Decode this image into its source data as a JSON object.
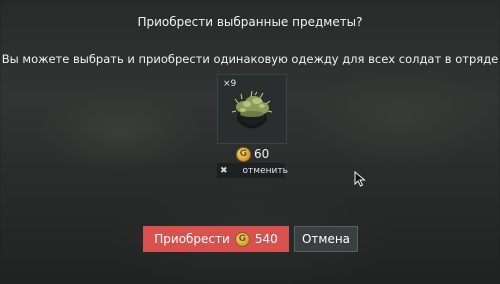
{
  "dialog": {
    "title": "Приобрести выбранные предметы?",
    "subtitle": "Вы можете выбрать и приобрести одинаковую одежду для всех солдат в отряде"
  },
  "item": {
    "icon": "ghillie-helmet-icon",
    "quantity": "×9",
    "price": "60",
    "currency_icon": "gold-coin-icon",
    "currency_symbol": "G",
    "remove_icon": "close-icon",
    "remove_label": "отменить"
  },
  "buttons": {
    "buy_label": "Приобрести",
    "buy_total": "540",
    "cancel_label": "Отмена"
  },
  "colors": {
    "buy_button": "#d9514f",
    "cancel_button": "#3a3f40",
    "coin": "#d8a53b"
  }
}
